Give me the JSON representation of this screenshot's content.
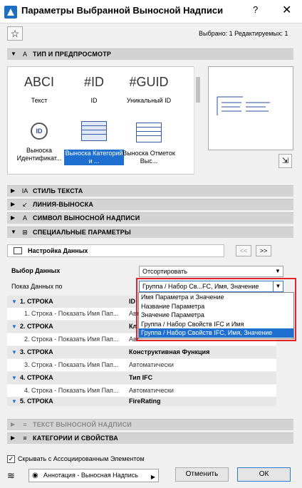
{
  "window": {
    "title": "Параметры Выбранной Выносной Надписи",
    "help": "?",
    "close": "✕"
  },
  "selection_info": "Выбрано: 1 Редактируемых: 1",
  "sections": {
    "type_preview": "ТИП И ПРЕДПРОСМОТР",
    "text_style": "СТИЛЬ ТЕКСТА",
    "leader_line": "ЛИНИЯ-ВЫНОСКА",
    "label_symbol": "СИМВОЛ ВЫНОСНОЙ НАДПИСИ",
    "special_params": "СПЕЦИАЛЬНЫЕ ПАРАМЕТРЫ",
    "label_text": "ТЕКСТ ВЫНОСНОЙ НАДПИСИ",
    "categories": "КАТЕГОРИИ И СВОЙСТВА"
  },
  "label_types": [
    {
      "glyph": "ABCI",
      "caption": "Текст"
    },
    {
      "glyph": "#ID",
      "caption": "ID"
    },
    {
      "glyph": "#GUID",
      "caption": "Уникальный ID"
    },
    {
      "glyph": "ID",
      "caption": "Выноска Идентификат..."
    },
    {
      "glyph": "",
      "caption": "Выноска Категорий и ..."
    },
    {
      "glyph": "",
      "caption": "Выноска Отметок Выс..."
    }
  ],
  "data_settings": {
    "header": "Настройка Данных",
    "prev": "<<",
    "next": ">>",
    "data_choice_label": "Выбор Данных",
    "data_choice_value": "Отсортировать",
    "show_data_label": "Показ Данных по",
    "show_data_value": "Группа / Набор Св...FC, Имя, Значение"
  },
  "dropdown_options": [
    "Имя Параметра и Значение",
    "Название Параметра",
    "Значение Параметра",
    "Группа / Набор Свойств IFC и Имя",
    "Группа / Набор Свойств IFC, Имя, Значение"
  ],
  "rows": [
    {
      "c1": "1. СТРОКА",
      "c2": "ID"
    },
    {
      "c1": "1. Строка - Показать Имя Пап...",
      "c2": "Авт"
    },
    {
      "c1": "2. СТРОКА",
      "c2": "Кл"
    },
    {
      "c1": "2. Строка - Показать Имя Пап...",
      "c2": "Авт"
    },
    {
      "c1": "3. СТРОКА",
      "c2": "Конструктивная Функция"
    },
    {
      "c1": "3. Строка - Показать Имя Пап...",
      "c2": "Автоматически"
    },
    {
      "c1": "4. СТРОКА",
      "c2": "Тип IFC"
    },
    {
      "c1": "4. Строка - Показать Имя Пап...",
      "c2": "Автоматически"
    },
    {
      "c1": "5. СТРОКА",
      "c2": "FireRating"
    }
  ],
  "footer": {
    "hide_checkbox": "Скрывать с Ассоциированным Элементом",
    "layer": "Аннотация - Выносная Надпись",
    "cancel": "Отменить",
    "ok": "ОК"
  }
}
